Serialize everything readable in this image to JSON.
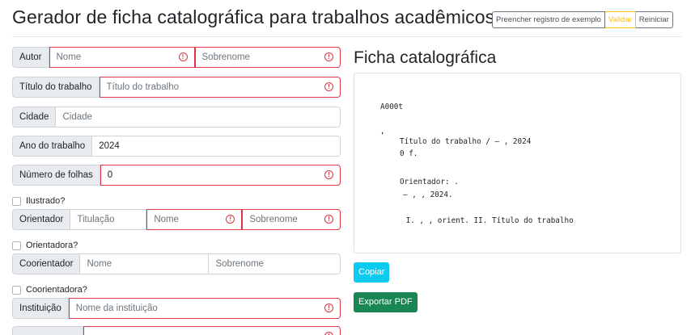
{
  "header": {
    "title": "Gerador de ficha catalográfica para trabalhos acadêmicos",
    "btn_example": "Preencher registro de exemplo",
    "btn_validate": "Validar",
    "btn_reset": "Reiniciar"
  },
  "form": {
    "autor": {
      "label": "Autor",
      "nome_placeholder": "Nome",
      "sobrenome_placeholder": "Sobrenome"
    },
    "titulo": {
      "label": "Título do trabalho",
      "placeholder": "Título do trabalho"
    },
    "cidade": {
      "label": "Cidade",
      "placeholder": "Cidade"
    },
    "ano": {
      "label": "Ano do trabalho",
      "value": "2024"
    },
    "folhas": {
      "label": "Número de folhas",
      "value": "0"
    },
    "ilustrado": {
      "label": "Ilustrado?"
    },
    "orientador": {
      "label": "Orientador",
      "titulacao_placeholder": "Titulação",
      "nome_placeholder": "Nome",
      "sobrenome_placeholder": "Sobrenome"
    },
    "orientadora": {
      "label": "Orientadora?"
    },
    "coorientador": {
      "label": "Coorientador",
      "nome_placeholder": "Nome",
      "sobrenome_placeholder": "Sobrenome"
    },
    "coorientadora": {
      "label": "Coorientadora?"
    },
    "instituicao": {
      "label": "Instituição",
      "placeholder": "Nome da instituição"
    }
  },
  "ficha": {
    "title": "Ficha catalográfica",
    "code": "A000t",
    "line_comma": ",",
    "line_title": "Título do trabalho / — , 2024",
    "line_pages": "0 f.",
    "line_orientador": "Orientador: .",
    "line_dash": "— , , 2024.",
    "line_subjects": " I. , , orient. II. Título do trabalho"
  },
  "actions": {
    "copy": "Copiar",
    "export_pdf": "Exportar PDF"
  },
  "colors": {
    "error": "#dc3545",
    "warning": "#ffc107",
    "info": "#0dcaf0",
    "success": "#198754"
  }
}
